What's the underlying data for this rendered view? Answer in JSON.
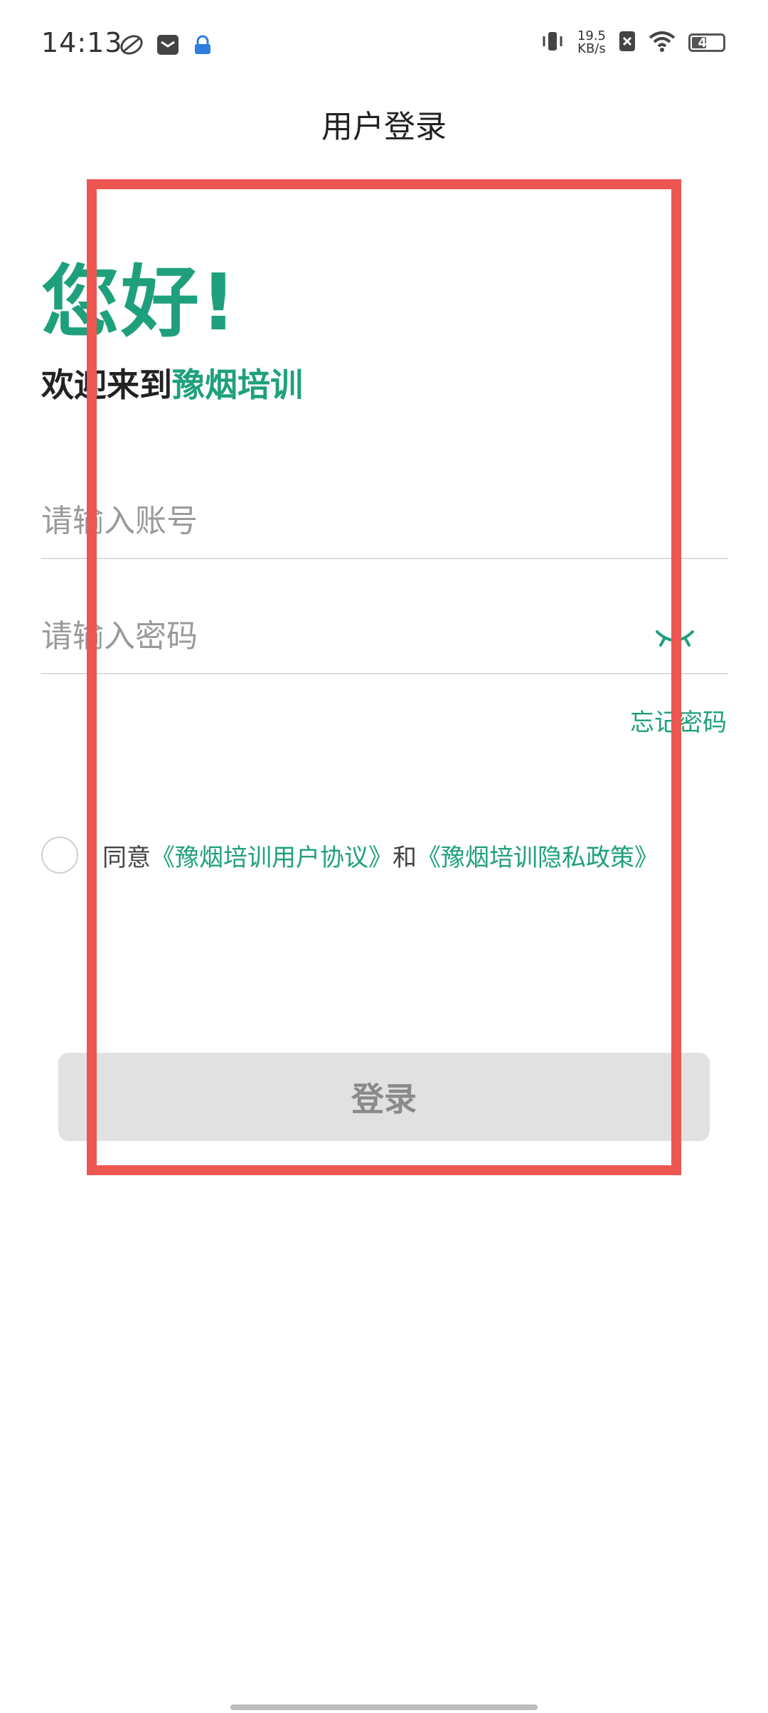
{
  "status_bar": {
    "time": "14:13",
    "network_speed_value": "19.5",
    "network_speed_unit": "KB/s",
    "battery_level": "43",
    "icons": [
      "leaf-icon",
      "mail-icon",
      "lock-app-icon",
      "vibrate-icon",
      "no-sim-icon",
      "wifi-icon",
      "battery-icon"
    ]
  },
  "header": {
    "title": "用户登录"
  },
  "greeting": {
    "hello": "您好!",
    "welcome_prefix": "欢迎来到",
    "brand": "豫烟培训"
  },
  "form": {
    "account_placeholder": "请输入账号",
    "password_placeholder": "请输入密码",
    "forgot_password": "忘记密码"
  },
  "agreement": {
    "prefix": "同意",
    "user_agreement": "《豫烟培训用户协议》",
    "conjunction": "和",
    "privacy_policy": "《豫烟培训隐私政策》"
  },
  "actions": {
    "login_label": "登录"
  },
  "colors": {
    "accent": "#1fa07d",
    "highlight": "#ee5652",
    "button_disabled_bg": "#e1e1e1"
  }
}
